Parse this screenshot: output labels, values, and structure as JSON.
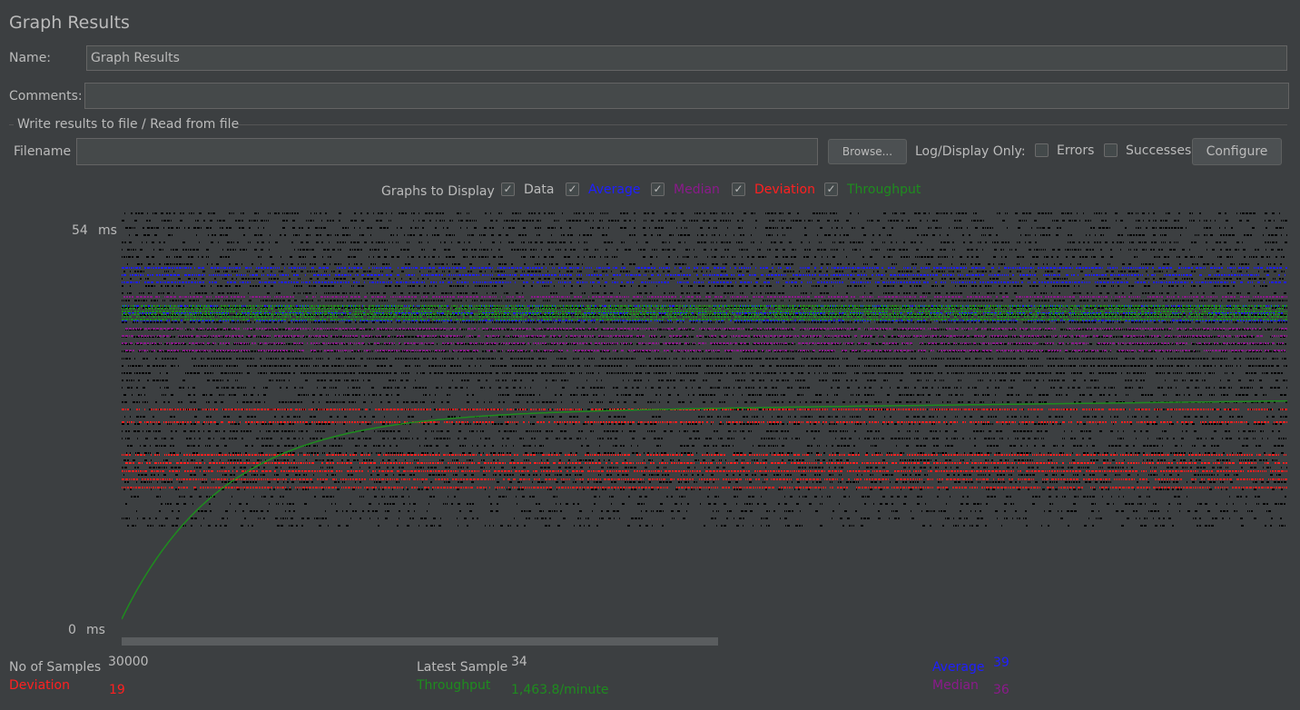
{
  "panel": {
    "title": "Graph Results"
  },
  "name_row": {
    "label": "Name:",
    "value": "Graph Results"
  },
  "comments_row": {
    "label": "Comments:",
    "value": ""
  },
  "file_section": {
    "title": "Write results to file / Read from file",
    "filename_label": "Filename",
    "filename_value": "",
    "browse_label": "Browse...",
    "log_display_label": "Log/Display Only:",
    "errors_label": "Errors",
    "errors_checked": false,
    "successes_label": "Successes",
    "successes_checked": false,
    "configure_label": "Configure"
  },
  "graphs_to_display": {
    "label": "Graphs to Display",
    "options": [
      {
        "label": "Data",
        "checked": true,
        "color": "#bbbbbb"
      },
      {
        "label": "Average",
        "checked": true,
        "color": "#1f1fff"
      },
      {
        "label": "Median",
        "checked": true,
        "color": "#8b1a8b"
      },
      {
        "label": "Deviation",
        "checked": true,
        "color": "#ff2020"
      },
      {
        "label": "Throughput",
        "checked": true,
        "color": "#1e8c1e"
      }
    ]
  },
  "chart_data": {
    "type": "scatter",
    "y_max_label": "54",
    "y_min_label": "0",
    "y_unit": "ms",
    "ylim": [
      0,
      54
    ],
    "series_colors": {
      "data": "#000000",
      "average": "#1f1fff",
      "median": "#8b1a8b",
      "deviation": "#ff2020",
      "throughput": "#1e8c1e"
    }
  },
  "stats": {
    "no_of_samples_label": "No of Samples",
    "no_of_samples_value": "30000",
    "deviation_label": "Deviation",
    "deviation_value": "19",
    "latest_sample_label": "Latest Sample",
    "latest_sample_value": "34",
    "throughput_label": "Throughput",
    "throughput_value": "1,463.8/minute",
    "average_label": "Average",
    "average_value": "39",
    "median_label": "Median",
    "median_value": "36"
  }
}
